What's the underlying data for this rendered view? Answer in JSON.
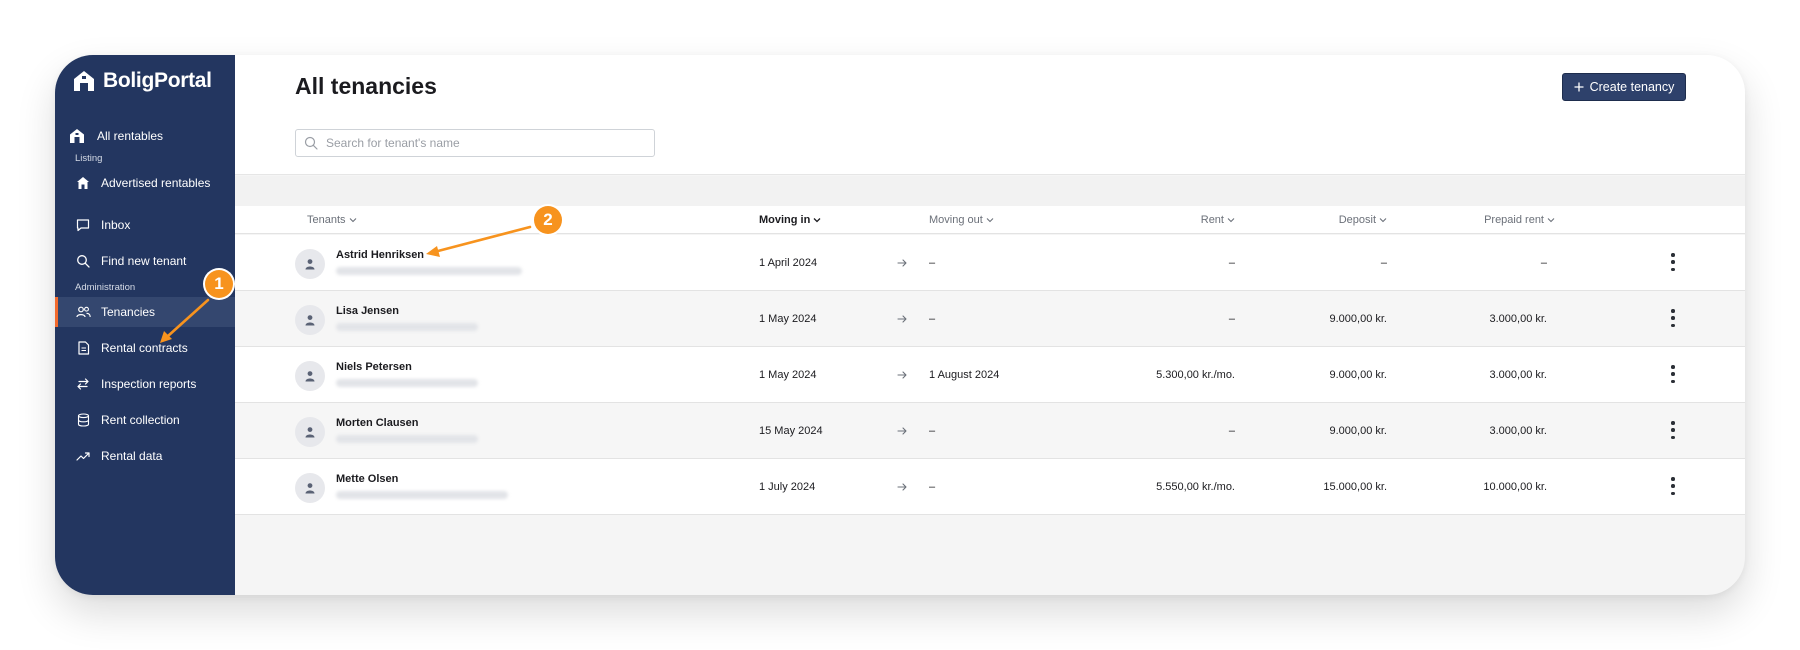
{
  "app": {
    "logo_text": "BoligPortal"
  },
  "sidebar": {
    "top_item": "All rentables",
    "sections": [
      {
        "label": "Listing"
      },
      {
        "label": "Administration"
      }
    ],
    "items": [
      {
        "label": "Advertised rentables",
        "icon": "home-icon"
      },
      {
        "label": "Inbox",
        "icon": "chat-icon"
      },
      {
        "label": "Find new tenant",
        "icon": "search-icon"
      },
      {
        "label": "Tenancies",
        "icon": "users-icon",
        "active": true
      },
      {
        "label": "Rental contracts",
        "icon": "document-icon"
      },
      {
        "label": "Inspection reports",
        "icon": "swap-icon"
      },
      {
        "label": "Rent collection",
        "icon": "database-icon"
      },
      {
        "label": "Rental data",
        "icon": "trend-icon"
      }
    ]
  },
  "main": {
    "title": "All tenancies",
    "create_button": "Create tenancy",
    "search_placeholder": "Search for tenant's name"
  },
  "table": {
    "columns": [
      "Tenants",
      "Moving in",
      "Moving out",
      "Rent",
      "Deposit",
      "Prepaid rent"
    ],
    "sorted_column": "Moving in",
    "rows": [
      {
        "name": "Astrid Henriksen",
        "moving_in": "1 April 2024",
        "moving_out": "–",
        "rent": "–",
        "deposit": "–",
        "prepaid": "–"
      },
      {
        "name": "Lisa Jensen",
        "moving_in": "1 May 2024",
        "moving_out": "–",
        "rent": "–",
        "deposit": "9.000,00 kr.",
        "prepaid": "3.000,00 kr."
      },
      {
        "name": "Niels Petersen",
        "moving_in": "1 May 2024",
        "moving_out": "1 August 2024",
        "rent": "5.300,00 kr./mo.",
        "deposit": "9.000,00 kr.",
        "prepaid": "3.000,00 kr."
      },
      {
        "name": "Morten Clausen",
        "moving_in": "15 May 2024",
        "moving_out": "–",
        "rent": "–",
        "deposit": "9.000,00 kr.",
        "prepaid": "3.000,00 kr."
      },
      {
        "name": "Mette Olsen",
        "moving_in": "1 July 2024",
        "moving_out": "–",
        "rent": "5.550,00 kr./mo.",
        "deposit": "15.000,00 kr.",
        "prepaid": "10.000,00 kr."
      }
    ]
  },
  "annotations": [
    {
      "number": "1"
    },
    {
      "number": "2"
    }
  ],
  "colors": {
    "sidebar": "#233660",
    "accent": "#f26a2d",
    "annotation": "#f7931e",
    "button": "#2e416b"
  }
}
